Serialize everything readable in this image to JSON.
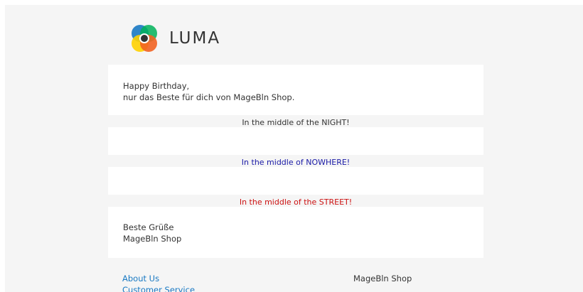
{
  "header": {
    "logo_text": "LUMA",
    "logo_icon": "luma-logo-icon",
    "logo_colors": [
      "#f26322",
      "#1979c3",
      "#ffd200",
      "#00b259"
    ]
  },
  "message": {
    "greeting_line1": "Happy Birthday,",
    "greeting_line2": "nur das Beste für dich von MageBln Shop."
  },
  "banners": {
    "night": {
      "text": "In the middle of the NIGHT!",
      "color": "#333333"
    },
    "nowhere": {
      "text": "In the middle of NOWHERE!",
      "color": "#1a1aa6"
    },
    "street": {
      "text": "In the middle of the STREET!",
      "color": "#cc1111"
    }
  },
  "closing": {
    "line1": "Beste Grüße",
    "line2": "MageBln Shop"
  },
  "footer": {
    "links": [
      "About Us",
      "Customer Service"
    ],
    "store_name": "MageBln Shop",
    "link_color": "#1979c3"
  }
}
